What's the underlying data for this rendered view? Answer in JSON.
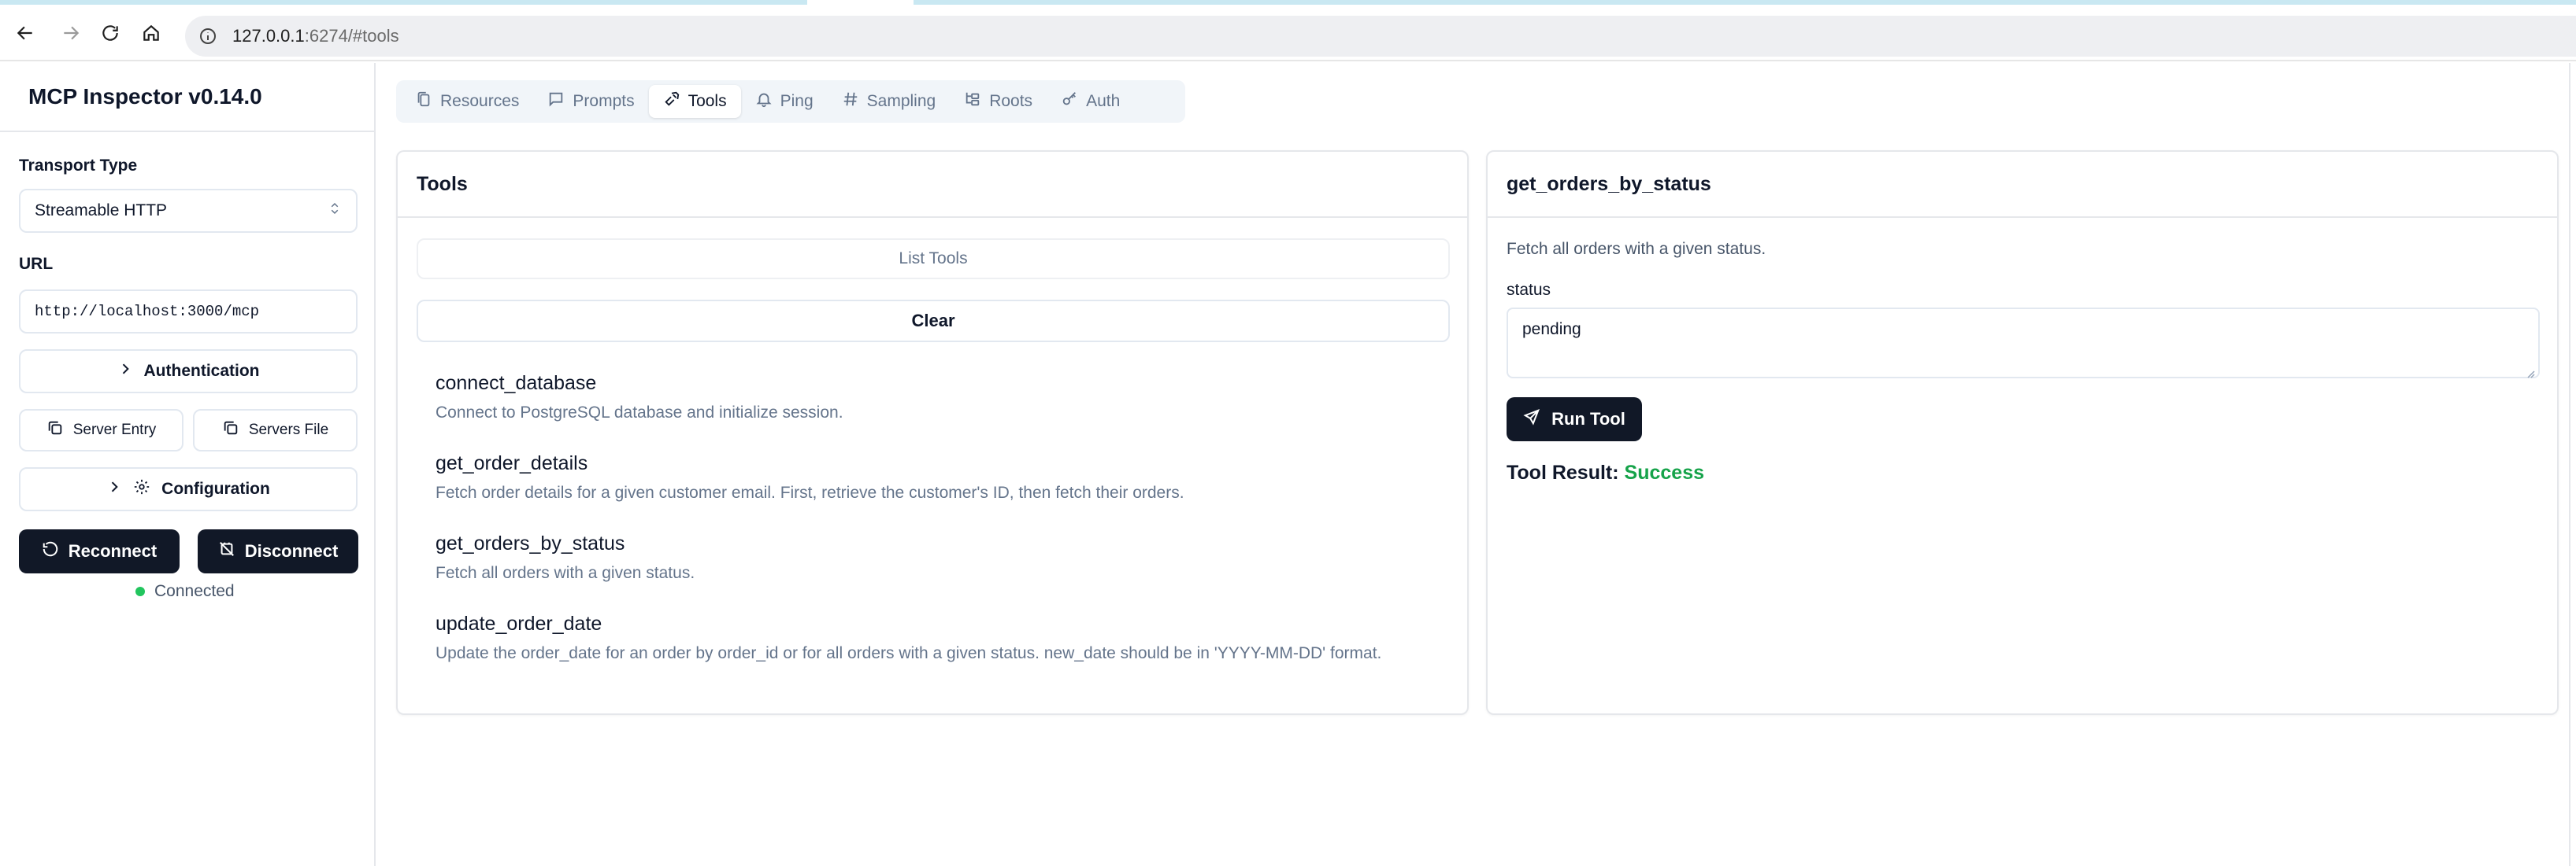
{
  "browser": {
    "url_host": "127.0.0.1",
    "url_rest": ":6274/#tools"
  },
  "sidebar": {
    "app_title": "MCP Inspector v0.14.0",
    "transport_label": "Transport Type",
    "transport_value": "Streamable HTTP",
    "url_label": "URL",
    "url_value": "http://localhost:3000/mcp",
    "authentication_label": "Authentication",
    "server_entry_label": "Server Entry",
    "servers_file_label": "Servers File",
    "configuration_label": "Configuration",
    "reconnect_label": "Reconnect",
    "disconnect_label": "Disconnect",
    "status_text": "Connected",
    "status_color": "#22c55e"
  },
  "tabs": [
    {
      "label": "Resources",
      "icon": "files-icon"
    },
    {
      "label": "Prompts",
      "icon": "message-square-icon"
    },
    {
      "label": "Tools",
      "icon": "hammer-icon"
    },
    {
      "label": "Ping",
      "icon": "bell-icon"
    },
    {
      "label": "Sampling",
      "icon": "hash-icon"
    },
    {
      "label": "Roots",
      "icon": "folder-tree-icon"
    },
    {
      "label": "Auth",
      "icon": "key-icon"
    }
  ],
  "active_tab": "Tools",
  "tools_panel": {
    "title": "Tools",
    "list_tools_label": "List Tools",
    "clear_label": "Clear",
    "tools": [
      {
        "name": "connect_database",
        "description": "Connect to PostgreSQL database and initialize session."
      },
      {
        "name": "get_order_details",
        "description": "Fetch order details for a given customer email. First, retrieve the customer's ID, then fetch their orders."
      },
      {
        "name": "get_orders_by_status",
        "description": "Fetch all orders with a given status."
      },
      {
        "name": "update_order_date",
        "description": "Update the order_date for an order by order_id or for all orders with a given status. new_date should be in 'YYYY-MM-DD' format."
      }
    ]
  },
  "detail_panel": {
    "title": "get_orders_by_status",
    "description": "Fetch all orders with a given status.",
    "param_label": "status",
    "param_value": "pending",
    "run_label": "Run Tool",
    "result_label": "Tool Result:",
    "result_value": "Success",
    "result_color": "#16a34a"
  }
}
